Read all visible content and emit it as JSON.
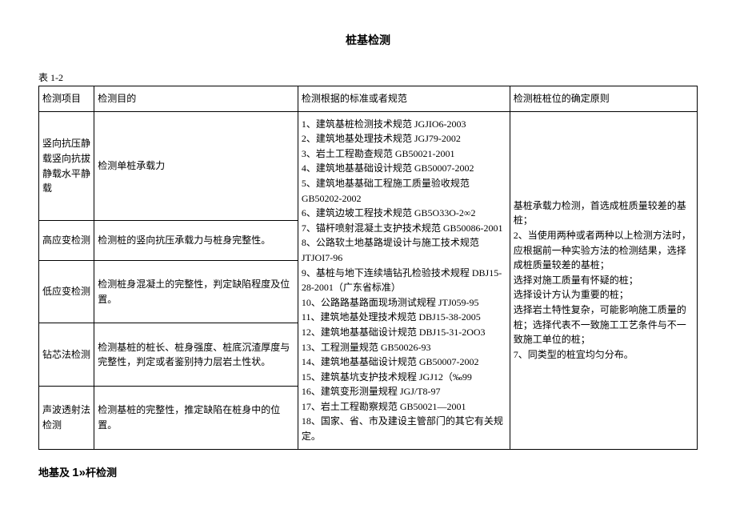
{
  "title": "桩基检测",
  "table_label": "表 1-2",
  "headers": {
    "item": "检测项目",
    "purpose": "检测目的",
    "basis": "检测根据的标准或者规范",
    "principle": "检测桩桩位的确定原则"
  },
  "rows": [
    {
      "item": "竖向抗压静载竖向抗拔静载水平静载",
      "purpose": "检测单桩承载力"
    },
    {
      "item": "高应变检测",
      "purpose": "检测桩的竖向抗压承载力与桩身完整性。"
    },
    {
      "item": "低应变检测",
      "purpose": "检测桩身混凝土的完整性，判定缺陷程度及位置。"
    },
    {
      "item": "钻芯法检测",
      "purpose": "检测基桩的桩长、桩身强度、桩底沉渣厚度与完整性，判定或者鉴别持力层岩土性状。"
    },
    {
      "item": "声波透射法检测",
      "purpose": "检测基桩的完整性，推定缺陷在桩身中的位置。"
    }
  ],
  "standards": [
    "1、建筑基桩检测技术规范 JGJIO6-2003",
    "2、建筑地基处理技术规范 JGJ79-2002",
    "3、岩土工程勘查规范 GB50021-2001",
    "4、建筑地基基础设计规范 GB50007-2002",
    "5、建筑地基基础工程施工质量验收规范 GB50202-2002",
    "6、建筑边坡工程技术规范 GB5O33O-2∞2",
    "7、锚杆喷射混凝土支护技术规范 GB50086-2001",
    "8、公路软土地基路堤设计与施工技术规范 JTJOI7-96",
    "9、基桩与地下连续墙钻孔检验技术规程 DBJ15-28-2001（广东省标准）",
    "10、公路路基路面现场测试规程 JTJ059-95",
    "11、建筑地基处理技术规范 DBJ15-38-2005",
    "12、建筑地基基础设计规范 DBJ15-31-2OO3",
    "13、工程测量规范 GB50026-93",
    "14、建筑地基基础设计规范 GB50007-2002",
    "15、建筑基坑支护技术规程 JGJ12（‰99",
    "16、建筑变形测量规程 JGJ/T8-97",
    "17、岩土工程勘察规范 GB50021—2001",
    "18、国家、省、市及建设主管部门的其它有关规定。"
  ],
  "principles": [
    "基桩承载力检测，首选成桩质量较差的基桩；",
    "2、当使用两种或者两种以上检测方法时，应根据前一种实验方法的检测结果，选择成桩质量较差的基桩；",
    "选择对施工质量有怀疑的桩；",
    "选择设计方认为重要的桩；",
    "选择岩土特性复杂，可能影响施工质量的桩；选择代表不一致施工工艺条件与不一致施工单位的桩；",
    "7、同类型的桩宜均匀分布。"
  ],
  "subtitle_prefix": "地基及 ",
  "subtitle_big": "1»",
  "subtitle_suffix": "杆检测"
}
